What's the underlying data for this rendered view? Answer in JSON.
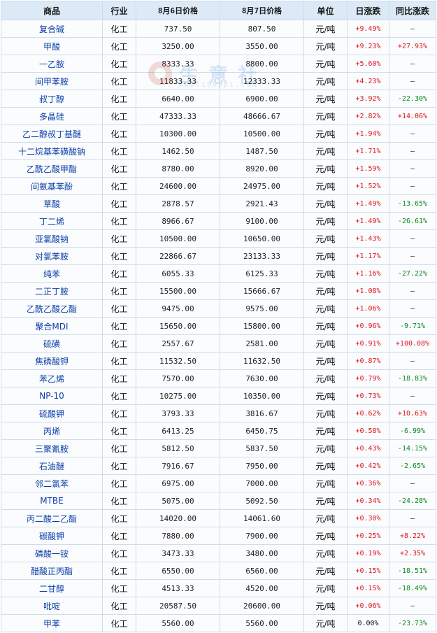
{
  "columns": [
    "商品",
    "行业",
    "8月6日价格",
    "8月7日价格",
    "单位",
    "日涨跌",
    "同比涨跌"
  ],
  "watermark": {
    "text": "生意社",
    "url": "www.100ppi.com"
  },
  "rows": [
    {
      "name": "复合碱",
      "industry": "化工",
      "p6": "737.50",
      "p7": "807.50",
      "unit": "元/吨",
      "day": "+9.49%",
      "yoy": "—"
    },
    {
      "name": "甲酸",
      "industry": "化工",
      "p6": "3250.00",
      "p7": "3550.00",
      "unit": "元/吨",
      "day": "+9.23%",
      "yoy": "+27.93%"
    },
    {
      "name": "一乙胺",
      "industry": "化工",
      "p6": "8333.33",
      "p7": "8800.00",
      "unit": "元/吨",
      "day": "+5.60%",
      "yoy": "—"
    },
    {
      "name": "间甲苯胺",
      "industry": "化工",
      "p6": "11833.33",
      "p7": "12333.33",
      "unit": "元/吨",
      "day": "+4.23%",
      "yoy": "—"
    },
    {
      "name": "叔丁醇",
      "industry": "化工",
      "p6": "6640.00",
      "p7": "6900.00",
      "unit": "元/吨",
      "day": "+3.92%",
      "yoy": "-22.30%"
    },
    {
      "name": "多晶硅",
      "industry": "化工",
      "p6": "47333.33",
      "p7": "48666.67",
      "unit": "元/吨",
      "day": "+2.82%",
      "yoy": "+14.06%"
    },
    {
      "name": "乙二醇叔丁基醚",
      "industry": "化工",
      "p6": "10300.00",
      "p7": "10500.00",
      "unit": "元/吨",
      "day": "+1.94%",
      "yoy": "—"
    },
    {
      "name": "十二烷基苯磺酸钠",
      "industry": "化工",
      "p6": "1462.50",
      "p7": "1487.50",
      "unit": "元/吨",
      "day": "+1.71%",
      "yoy": "—"
    },
    {
      "name": "乙酰乙酸甲酯",
      "industry": "化工",
      "p6": "8780.00",
      "p7": "8920.00",
      "unit": "元/吨",
      "day": "+1.59%",
      "yoy": "—"
    },
    {
      "name": "间氨基苯酚",
      "industry": "化工",
      "p6": "24600.00",
      "p7": "24975.00",
      "unit": "元/吨",
      "day": "+1.52%",
      "yoy": "—"
    },
    {
      "name": "草酸",
      "industry": "化工",
      "p6": "2878.57",
      "p7": "2921.43",
      "unit": "元/吨",
      "day": "+1.49%",
      "yoy": "-13.65%"
    },
    {
      "name": "丁二烯",
      "industry": "化工",
      "p6": "8966.67",
      "p7": "9100.00",
      "unit": "元/吨",
      "day": "+1.49%",
      "yoy": "-26.61%"
    },
    {
      "name": "亚氯酸钠",
      "industry": "化工",
      "p6": "10500.00",
      "p7": "10650.00",
      "unit": "元/吨",
      "day": "+1.43%",
      "yoy": "—"
    },
    {
      "name": "对氯苯胺",
      "industry": "化工",
      "p6": "22866.67",
      "p7": "23133.33",
      "unit": "元/吨",
      "day": "+1.17%",
      "yoy": "—"
    },
    {
      "name": "纯苯",
      "industry": "化工",
      "p6": "6055.33",
      "p7": "6125.33",
      "unit": "元/吨",
      "day": "+1.16%",
      "yoy": "-27.22%"
    },
    {
      "name": "二正丁胺",
      "industry": "化工",
      "p6": "15500.00",
      "p7": "15666.67",
      "unit": "元/吨",
      "day": "+1.08%",
      "yoy": "—"
    },
    {
      "name": "乙酰乙酸乙酯",
      "industry": "化工",
      "p6": "9475.00",
      "p7": "9575.00",
      "unit": "元/吨",
      "day": "+1.06%",
      "yoy": "—"
    },
    {
      "name": "聚合MDI",
      "industry": "化工",
      "p6": "15650.00",
      "p7": "15800.00",
      "unit": "元/吨",
      "day": "+0.96%",
      "yoy": "-9.71%"
    },
    {
      "name": "硫磺",
      "industry": "化工",
      "p6": "2557.67",
      "p7": "2581.00",
      "unit": "元/吨",
      "day": "+0.91%",
      "yoy": "+100.08%"
    },
    {
      "name": "焦磷酸钾",
      "industry": "化工",
      "p6": "11532.50",
      "p7": "11632.50",
      "unit": "元/吨",
      "day": "+0.87%",
      "yoy": "—"
    },
    {
      "name": "苯乙烯",
      "industry": "化工",
      "p6": "7570.00",
      "p7": "7630.00",
      "unit": "元/吨",
      "day": "+0.79%",
      "yoy": "-18.83%"
    },
    {
      "name": "NP-10",
      "industry": "化工",
      "p6": "10275.00",
      "p7": "10350.00",
      "unit": "元/吨",
      "day": "+0.73%",
      "yoy": "—"
    },
    {
      "name": "硫酸钾",
      "industry": "化工",
      "p6": "3793.33",
      "p7": "3816.67",
      "unit": "元/吨",
      "day": "+0.62%",
      "yoy": "+10.63%"
    },
    {
      "name": "丙烯",
      "industry": "化工",
      "p6": "6413.25",
      "p7": "6450.75",
      "unit": "元/吨",
      "day": "+0.58%",
      "yoy": "-6.99%"
    },
    {
      "name": "三聚氰胺",
      "industry": "化工",
      "p6": "5812.50",
      "p7": "5837.50",
      "unit": "元/吨",
      "day": "+0.43%",
      "yoy": "-14.15%"
    },
    {
      "name": "石油醚",
      "industry": "化工",
      "p6": "7916.67",
      "p7": "7950.00",
      "unit": "元/吨",
      "day": "+0.42%",
      "yoy": "-2.65%"
    },
    {
      "name": "邻二氯苯",
      "industry": "化工",
      "p6": "6975.00",
      "p7": "7000.00",
      "unit": "元/吨",
      "day": "+0.36%",
      "yoy": "—"
    },
    {
      "name": "MTBE",
      "industry": "化工",
      "p6": "5075.00",
      "p7": "5092.50",
      "unit": "元/吨",
      "day": "+0.34%",
      "yoy": "-24.28%"
    },
    {
      "name": "丙二酸二乙酯",
      "industry": "化工",
      "p6": "14020.00",
      "p7": "14061.60",
      "unit": "元/吨",
      "day": "+0.30%",
      "yoy": "—"
    },
    {
      "name": "碳酸钾",
      "industry": "化工",
      "p6": "7880.00",
      "p7": "7900.00",
      "unit": "元/吨",
      "day": "+0.25%",
      "yoy": "+8.22%"
    },
    {
      "name": "磷酸一铵",
      "industry": "化工",
      "p6": "3473.33",
      "p7": "3480.00",
      "unit": "元/吨",
      "day": "+0.19%",
      "yoy": "+2.35%"
    },
    {
      "name": "醋酸正丙酯",
      "industry": "化工",
      "p6": "6550.00",
      "p7": "6560.00",
      "unit": "元/吨",
      "day": "+0.15%",
      "yoy": "-18.51%"
    },
    {
      "name": "二甘醇",
      "industry": "化工",
      "p6": "4513.33",
      "p7": "4520.00",
      "unit": "元/吨",
      "day": "+0.15%",
      "yoy": "-18.49%"
    },
    {
      "name": "吡啶",
      "industry": "化工",
      "p6": "20587.50",
      "p7": "20600.00",
      "unit": "元/吨",
      "day": "+0.06%",
      "yoy": "—"
    },
    {
      "name": "甲苯",
      "industry": "化工",
      "p6": "5560.00",
      "p7": "5560.00",
      "unit": "元/吨",
      "day": "0.00%",
      "yoy": "-23.73%"
    }
  ]
}
